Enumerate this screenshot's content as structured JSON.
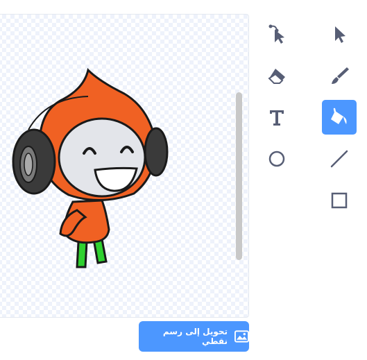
{
  "colors": {
    "accent": "#4c97ff",
    "icon": "#575e75",
    "scrollbar": "#c8c8c8"
  },
  "tools": [
    {
      "name": "reshape",
      "icon": "reshape-icon"
    },
    {
      "name": "select",
      "icon": "select-arrow-icon"
    },
    {
      "name": "eraser",
      "icon": "eraser-icon"
    },
    {
      "name": "brush",
      "icon": "brush-icon"
    },
    {
      "name": "text",
      "icon": "text-icon"
    },
    {
      "name": "fill",
      "icon": "fill-bucket-icon",
      "active": true
    },
    {
      "name": "circle",
      "icon": "circle-icon"
    },
    {
      "name": "line",
      "icon": "line-icon"
    },
    {
      "name": "rectangle",
      "icon": "rectangle-icon"
    }
  ],
  "convert_button": {
    "label": "تحويل إلى رسم نقطي",
    "icon": "bitmap-image-icon"
  }
}
